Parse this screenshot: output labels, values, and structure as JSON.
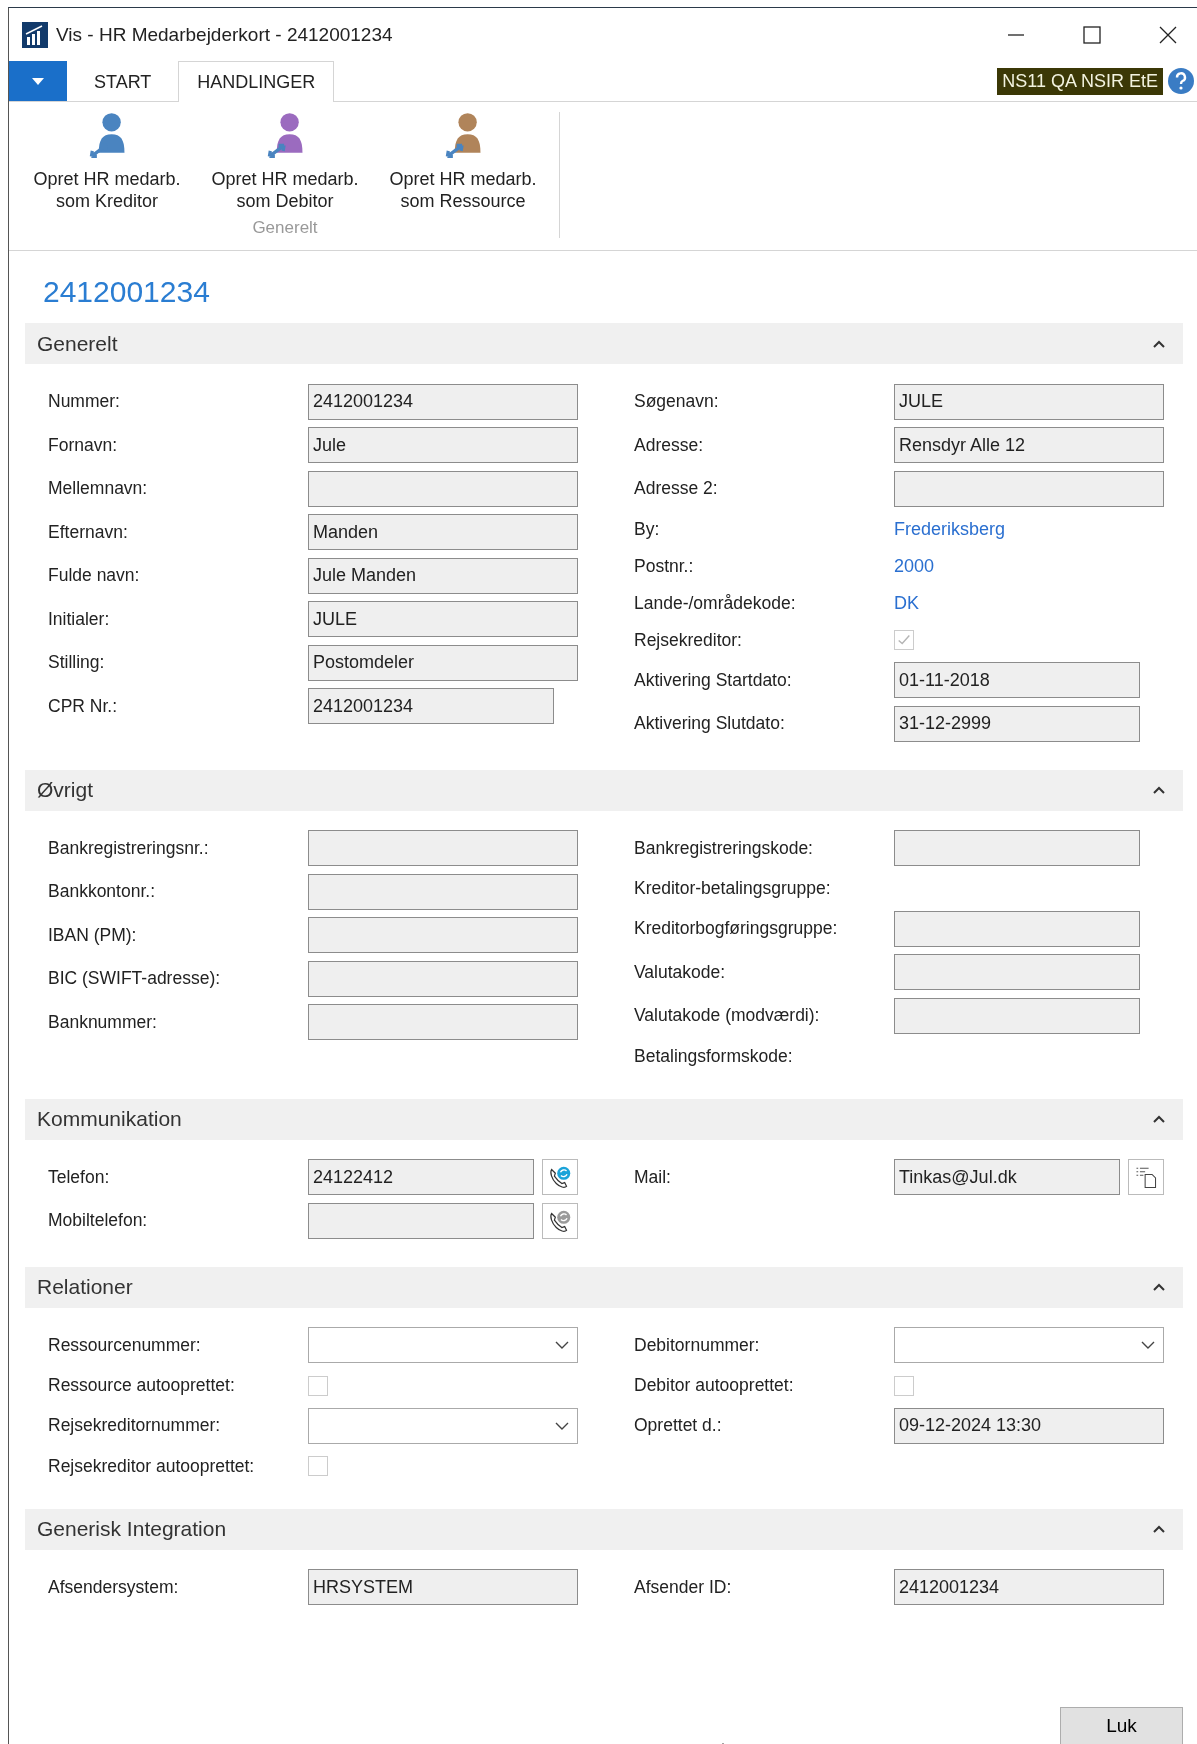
{
  "window": {
    "title": "Vis - HR Medarbejderkort - 2412001234"
  },
  "tabs": [
    {
      "label": "START",
      "selected": false
    },
    {
      "label": "HANDLINGER",
      "selected": true
    }
  ],
  "company_badge": "NS11 QA NSIR EtE",
  "ribbon": {
    "group": "Generelt",
    "actions": [
      {
        "label": "Opret HR medarb. som Kreditor",
        "color": "#4a84c0"
      },
      {
        "label": "Opret HR medarb. som Debitor",
        "color": "#9b6bbf"
      },
      {
        "label": "Opret HR medarb. som Ressource",
        "color": "#b0845a"
      }
    ]
  },
  "page_title": "2412001234",
  "sections": [
    {
      "title": "Generelt",
      "expanded": true,
      "left": [
        {
          "label": "Nummer:",
          "kind": "text",
          "value": "2412001234"
        },
        {
          "label": "Fornavn:",
          "kind": "text",
          "value": "Jule"
        },
        {
          "label": "Mellemnavn:",
          "kind": "text"
        },
        {
          "label": "Efternavn:",
          "kind": "text",
          "value": "Manden"
        },
        {
          "label": "Fulde navn:",
          "kind": "text",
          "value": "Jule Manden"
        },
        {
          "label": "Initialer:",
          "kind": "text",
          "value": "JULE"
        },
        {
          "label": "Stilling:",
          "kind": "text",
          "value": "Postomdeler"
        },
        {
          "label": "CPR Nr.:",
          "kind": "short",
          "value": "2412001234"
        }
      ],
      "right": [
        {
          "label": "Søgenavn:",
          "kind": "text",
          "value": "JULE"
        },
        {
          "label": "Adresse:",
          "kind": "text",
          "value": "Rensdyr Alle 12"
        },
        {
          "label": "Adresse 2:",
          "kind": "text"
        },
        {
          "label": "By:",
          "kind": "link",
          "value": "Frederiksberg"
        },
        {
          "label": "Postnr.:",
          "kind": "link",
          "value": "2000"
        },
        {
          "label": "Lande-/områdekode:",
          "kind": "link",
          "value": "DK"
        },
        {
          "label": "Rejsekreditor:",
          "kind": "checkbox",
          "checked": true
        },
        {
          "label": "Aktivering Startdato:",
          "kind": "short",
          "value": "01-11-2018"
        },
        {
          "label": "Aktivering Slutdato:",
          "kind": "short",
          "value": "31-12-2999"
        }
      ]
    },
    {
      "title": "Øvrigt",
      "expanded": true,
      "left": [
        {
          "label": "Bankregistreringsnr.:",
          "kind": "text"
        },
        {
          "label": "Bankkontonr.:",
          "kind": "text"
        },
        {
          "label": "IBAN (PM):",
          "kind": "text"
        },
        {
          "label": "BIC (SWIFT-adresse):",
          "kind": "text"
        },
        {
          "label": "Banknummer:",
          "kind": "text"
        }
      ],
      "right": [
        {
          "label": "Bankregistreringskode:",
          "kind": "short"
        },
        {
          "label": "Kreditor-betalingsgruppe:",
          "kind": "none"
        },
        {
          "label": "Kreditorbogføringsgruppe:",
          "kind": "short"
        },
        {
          "label": "Valutakode:",
          "kind": "short"
        },
        {
          "label": "Valutakode (modværdi):",
          "kind": "short"
        },
        {
          "label": "Betalingsformskode:",
          "kind": "none"
        }
      ]
    },
    {
      "title": "Kommunikation",
      "expanded": true,
      "left": [
        {
          "label": "Telefon:",
          "kind": "phone",
          "value": "24122412",
          "disabled": false
        },
        {
          "label": "Mobiltelefon:",
          "kind": "phone",
          "disabled": true
        }
      ],
      "right": [
        {
          "label": "Mail:",
          "kind": "mail",
          "value": "Tinkas@Jul.dk"
        }
      ]
    },
    {
      "title": "Relationer",
      "expanded": true,
      "left": [
        {
          "label": "Ressourcenummer:",
          "kind": "dropdown"
        },
        {
          "label": "Ressource autooprettet:",
          "kind": "checkbox",
          "checked": false
        },
        {
          "label": "Rejsekreditornummer:",
          "kind": "dropdown"
        },
        {
          "label": "Rejsekreditor autooprettet:",
          "kind": "checkbox",
          "checked": false
        }
      ],
      "right": [
        {
          "label": "Debitornummer:",
          "kind": "dropdown"
        },
        {
          "label": "Debitor autooprettet:",
          "kind": "checkbox",
          "checked": false
        },
        {
          "label": "Oprettet d.:",
          "kind": "text",
          "value": "09-12-2024 13:30"
        }
      ]
    },
    {
      "title": "Generisk Integration",
      "expanded": true,
      "left": [
        {
          "label": "Afsendersystem:",
          "kind": "text",
          "value": "HRSYSTEM"
        }
      ],
      "right": [
        {
          "label": "Afsender ID:",
          "kind": "text",
          "value": "2412001234"
        }
      ]
    }
  ],
  "close_button": "Luk"
}
